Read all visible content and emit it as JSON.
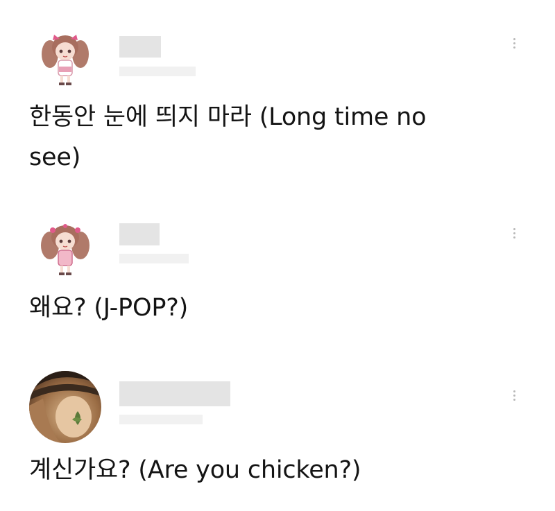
{
  "posts": [
    {
      "avatar_icon": "anime-girl-avatar-icon",
      "author": "",
      "line1": "한동안 눈에 띄지 마라 (Long time no",
      "line2": "see)",
      "menu_icon": "vertical-dots-icon"
    },
    {
      "avatar_icon": "anime-girl-avatar-icon",
      "author": "",
      "line1": "왜요? (J-POP?)",
      "menu_icon": "vertical-dots-icon"
    },
    {
      "avatar_icon": "hat-figure-avatar-icon",
      "author": "",
      "line1": "계신가요? (Are you chicken?)",
      "menu_icon": "vertical-dots-icon"
    }
  ],
  "colors": {
    "background": "#ffffff",
    "text": "#141414",
    "redaction": "#e4e4e4",
    "menu_dots": "#b8b8b8",
    "avatar_hair": "#b07a6a",
    "avatar_bow": "#e05a8a"
  }
}
